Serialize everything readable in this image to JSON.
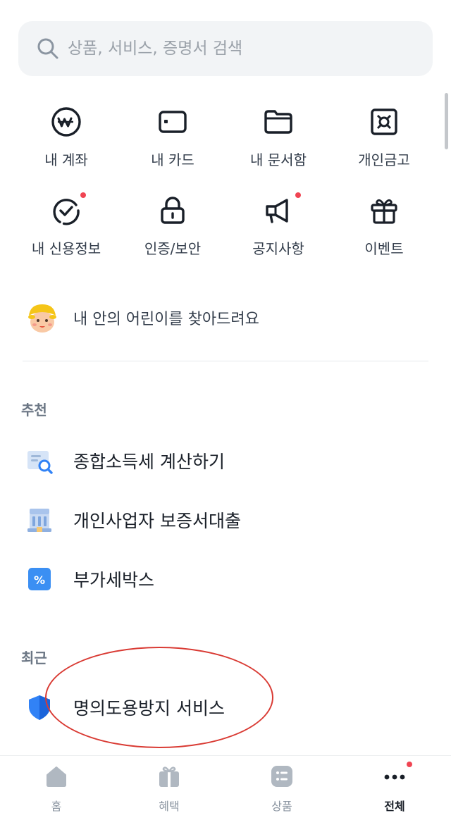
{
  "search": {
    "placeholder": "상품, 서비스, 증명서 검색",
    "icon": "search-icon"
  },
  "quick_menu": [
    {
      "label": "내 계좌",
      "icon": "won-coin-icon",
      "badge": false
    },
    {
      "label": "내 카드",
      "icon": "card-icon",
      "badge": false
    },
    {
      "label": "내 문서함",
      "icon": "folder-icon",
      "badge": false
    },
    {
      "label": "개인금고",
      "icon": "safe-icon",
      "badge": false
    },
    {
      "label": "내 신용정보",
      "icon": "credit-check-icon",
      "badge": true
    },
    {
      "label": "인증/보안",
      "icon": "lock-icon",
      "badge": false
    },
    {
      "label": "공지사항",
      "icon": "megaphone-icon",
      "badge": true
    },
    {
      "label": "이벤트",
      "icon": "gift-icon",
      "badge": false
    }
  ],
  "banner": {
    "text": "내 안의 어린이를 찾아드려요",
    "icon": "child-face-icon"
  },
  "recommended": {
    "title": "추천",
    "items": [
      {
        "label": "종합소득세 계산하기",
        "icon": "tax-document-search-icon"
      },
      {
        "label": "개인사업자 보증서대출",
        "icon": "bank-building-icon"
      },
      {
        "label": "부가세박스",
        "icon": "percent-box-icon"
      }
    ]
  },
  "recent": {
    "title": "최근",
    "items": [
      {
        "label": "명의도용방지 서비스",
        "icon": "shield-icon"
      }
    ]
  },
  "bottom_nav": [
    {
      "label": "홈",
      "icon": "home-icon",
      "active": false
    },
    {
      "label": "혜택",
      "icon": "gift-tab-icon",
      "active": false
    },
    {
      "label": "상품",
      "icon": "products-list-icon",
      "active": false
    },
    {
      "label": "전체",
      "icon": "more-dots-icon",
      "active": true,
      "badge": true
    }
  ],
  "colors": {
    "accent_red": "#f04452",
    "annotation_red": "#d93a33",
    "text_primary": "#191f28",
    "text_secondary": "#6b7684"
  }
}
